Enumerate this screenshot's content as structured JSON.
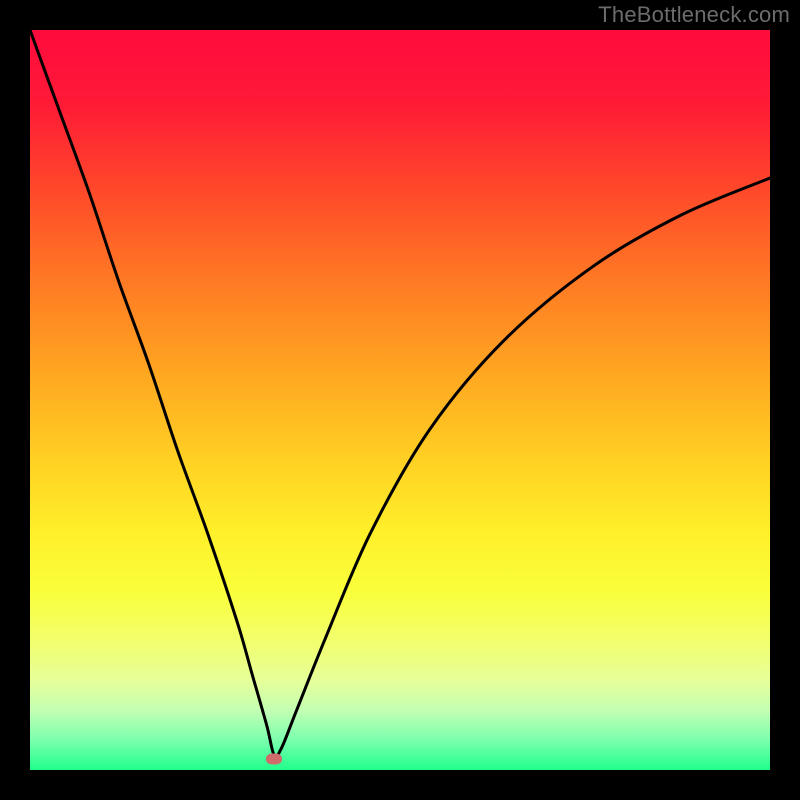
{
  "watermark": {
    "text": "TheBottleneck.com"
  },
  "chart_data": {
    "type": "line",
    "title": "",
    "xlabel": "",
    "ylabel": "",
    "xlim": [
      0,
      100
    ],
    "ylim": [
      0,
      100
    ],
    "grid": false,
    "legend": false,
    "background": "vertical-gradient",
    "gradient_stops": [
      {
        "pos": 0,
        "color": "#ff0b3e"
      },
      {
        "pos": 50,
        "color": "#ffc322"
      },
      {
        "pos": 82,
        "color": "#f3ff68"
      },
      {
        "pos": 100,
        "color": "#1fff8b"
      }
    ],
    "series": [
      {
        "name": "bottleneck-curve",
        "color": "#000000",
        "x": [
          0,
          4,
          8,
          12,
          16,
          20,
          24,
          28,
          30,
          32,
          33,
          34,
          36,
          40,
          46,
          54,
          64,
          76,
          88,
          100
        ],
        "y": [
          100,
          89,
          78,
          66,
          55,
          43,
          32,
          20,
          13,
          6,
          2,
          3,
          8,
          18,
          32,
          46,
          58,
          68,
          75,
          80
        ]
      }
    ],
    "marker": {
      "x": 33,
      "y": 1.5,
      "color": "#cf6b6b",
      "shape": "pill"
    }
  }
}
